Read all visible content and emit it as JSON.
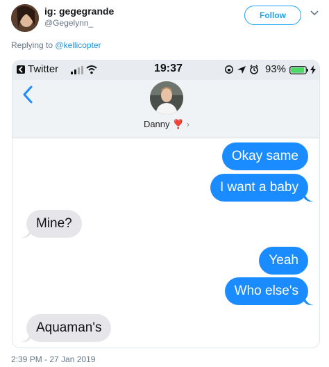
{
  "tweet": {
    "display_name": "ig: gegegrande",
    "handle": "@Gegelynn_",
    "follow_label": "Follow",
    "replying_prefix": "Replying to",
    "replying_to": "@kellicopter",
    "timestamp": "2:39 PM - 27 Jan 2019",
    "accent_color": "#1da1f2",
    "icons": {
      "more": "chevron-down-icon"
    }
  },
  "screenshot": {
    "status_bar": {
      "back_app": "Twitter",
      "time": "19:37",
      "battery_pct": "93%",
      "battery_level": 0.93,
      "icons": [
        "signal-icon",
        "wifi-icon",
        "screen-rotation-lock-icon",
        "location-icon",
        "alarm-icon",
        "battery-icon",
        "charging-icon"
      ]
    },
    "conversation": {
      "contact_name": "Danny",
      "contact_emoji": "❣️",
      "contact_chevron": "›",
      "messages": [
        {
          "text": "Okay same",
          "direction": "sent"
        },
        {
          "text": "I want a baby",
          "direction": "sent"
        },
        {
          "text": "Mine?",
          "direction": "received"
        },
        {
          "text": "Yeah",
          "direction": "sent"
        },
        {
          "text": "Who else's",
          "direction": "sent"
        },
        {
          "text": "Aquaman's",
          "direction": "received"
        }
      ],
      "colors": {
        "sent": "#1a8cff",
        "received": "#e5e5ea"
      }
    }
  }
}
